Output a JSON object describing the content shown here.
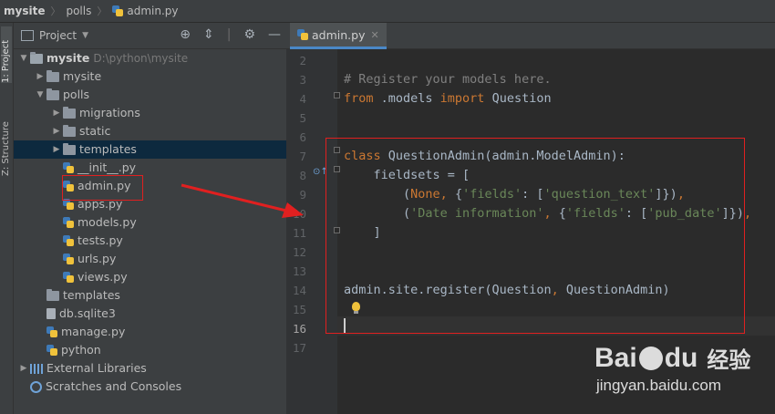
{
  "breadcrumb": {
    "items": [
      "mysite",
      "polls",
      "admin.py"
    ],
    "separator": "〉"
  },
  "side_tabs": {
    "project": "1: Project",
    "structure": "Z: Structure"
  },
  "project_panel": {
    "title": "Project",
    "header_icons": [
      "locate-icon",
      "collapse-icon",
      "settings-icon",
      "hide-icon"
    ],
    "tree": [
      {
        "label": "mysite",
        "path": "D:\\python\\mysite",
        "level": 0,
        "expanded": true,
        "kind": "root"
      },
      {
        "label": "mysite",
        "level": 1,
        "expanded": false,
        "kind": "folder"
      },
      {
        "label": "polls",
        "level": 1,
        "expanded": true,
        "kind": "folder"
      },
      {
        "label": "migrations",
        "level": 2,
        "expanded": false,
        "kind": "folder"
      },
      {
        "label": "static",
        "level": 2,
        "expanded": false,
        "kind": "folder"
      },
      {
        "label": "templates",
        "level": 2,
        "expanded": false,
        "kind": "folder",
        "selected": true
      },
      {
        "label": "__init__.py",
        "level": 2,
        "kind": "py"
      },
      {
        "label": "admin.py",
        "level": 2,
        "kind": "py",
        "highlighted": true
      },
      {
        "label": "apps.py",
        "level": 2,
        "kind": "py"
      },
      {
        "label": "models.py",
        "level": 2,
        "kind": "py"
      },
      {
        "label": "tests.py",
        "level": 2,
        "kind": "py"
      },
      {
        "label": "urls.py",
        "level": 2,
        "kind": "py"
      },
      {
        "label": "views.py",
        "level": 2,
        "kind": "py"
      },
      {
        "label": "templates",
        "level": 1,
        "kind": "folder-noarrow"
      },
      {
        "label": "db.sqlite3",
        "level": 1,
        "kind": "file"
      },
      {
        "label": "manage.py",
        "level": 1,
        "kind": "py"
      },
      {
        "label": "python",
        "level": 1,
        "kind": "py"
      },
      {
        "label": "External Libraries",
        "level": 0,
        "expanded": false,
        "kind": "lib"
      },
      {
        "label": "Scratches and Consoles",
        "level": 0,
        "kind": "scratch"
      }
    ]
  },
  "editor": {
    "tab_label": "admin.py",
    "current_line": 16,
    "lines": [
      {
        "n": 2,
        "code": ""
      },
      {
        "n": 3,
        "code": "# Register your models here."
      },
      {
        "n": 4,
        "code": "from .models import Question"
      },
      {
        "n": 5,
        "code": ""
      },
      {
        "n": 6,
        "code": ""
      },
      {
        "n": 7,
        "code": "class QuestionAdmin(admin.ModelAdmin):"
      },
      {
        "n": 8,
        "code": "    fieldsets = ["
      },
      {
        "n": 9,
        "code": "        (None, {'fields': ['question_text']}),"
      },
      {
        "n": 10,
        "code": "        ('Date information', {'fields': ['pub_date']}),"
      },
      {
        "n": 11,
        "code": "    ]"
      },
      {
        "n": 12,
        "code": ""
      },
      {
        "n": 13,
        "code": ""
      },
      {
        "n": 14,
        "code": "admin.site.register(Question, QuestionAdmin)"
      },
      {
        "n": 15,
        "code": ""
      },
      {
        "n": 16,
        "code": ""
      },
      {
        "n": 17,
        "code": ""
      }
    ]
  },
  "watermark": {
    "logo_a": "Bai",
    "logo_b": "du",
    "logo_cn": "经验",
    "url": "jingyan.baidu.com"
  },
  "colors": {
    "annotation_red": "#e02020",
    "keyword": "#cc7832",
    "comment": "#808080",
    "string": "#6a8759",
    "selection": "#0d293e"
  }
}
